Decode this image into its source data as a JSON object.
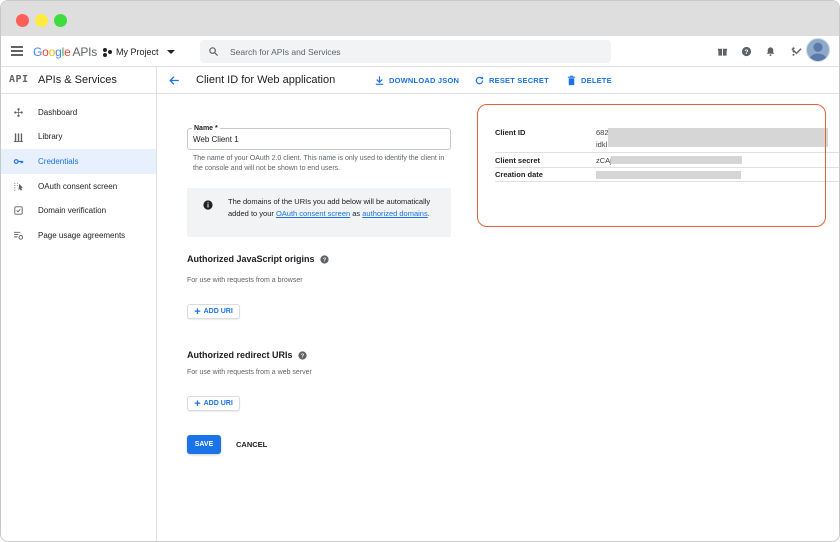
{
  "window": {
    "title_dots": [
      "close",
      "minimize",
      "maximize"
    ]
  },
  "topbar": {
    "logo_google": [
      "G",
      "o",
      "o",
      "g",
      "l",
      "e"
    ],
    "logo_apis": "APIs",
    "project_name": "My Project",
    "search_placeholder": "Search for APIs and Services",
    "icons": [
      "gift-icon",
      "help-icon",
      "bell-icon",
      "more-icon",
      "avatar"
    ]
  },
  "sidebar": {
    "glyph": "API",
    "title": "APIs & Services",
    "items": [
      {
        "label": "Dashboard",
        "icon": "dashboard-icon",
        "active": false
      },
      {
        "label": "Library",
        "icon": "library-icon",
        "active": false
      },
      {
        "label": "Credentials",
        "icon": "key-icon",
        "active": true
      },
      {
        "label": "OAuth consent screen",
        "icon": "consent-icon",
        "active": false
      },
      {
        "label": "Domain verification",
        "icon": "checkbox-icon",
        "active": false
      },
      {
        "label": "Page usage agreements",
        "icon": "settings-list-icon",
        "active": false
      }
    ]
  },
  "header": {
    "title": "Client ID for Web application",
    "download_json": "DOWNLOAD JSON",
    "reset_secret": "RESET SECRET",
    "delete": "DELETE"
  },
  "form": {
    "name_label": "Name *",
    "name_value": "Web Client 1",
    "name_helper": "The name of your OAuth 2.0 client. This name is only used to identify the client in the console and will not be shown to end users.",
    "info_text_1": "The domains of the URIs you add below will be automatically added to your ",
    "info_link_1": "OAuth consent screen",
    "info_text_2": " as ",
    "info_link_2": "authorized domains",
    "info_text_3": ".",
    "js_origins_title": "Authorized JavaScript origins",
    "js_origins_sub": "For use with requests from a browser",
    "redirect_title": "Authorized redirect URIs",
    "redirect_sub": "For use with requests from a web server",
    "add_uri": "ADD URI",
    "save": "SAVE",
    "cancel": "CANCEL"
  },
  "details": {
    "client_id_label": "Client ID",
    "client_id_value_line1": "682",
    "client_id_value_line2": "idkl",
    "client_secret_label": "Client secret",
    "client_secret_value": "zCAj",
    "creation_date_label": "Creation date"
  },
  "colors": {
    "accent": "#1a73e8",
    "active_bg": "#e8f0fe",
    "highlight_outline": "#e0643a"
  }
}
